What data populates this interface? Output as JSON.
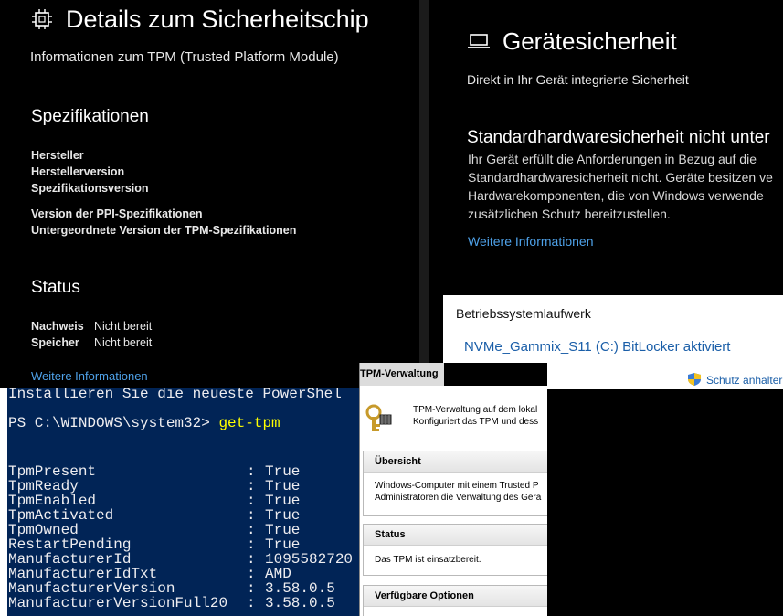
{
  "chip_details": {
    "title": "Details zum Sicherheitschip",
    "subtitle": "Informationen zum TPM (Trusted Platform Module)",
    "spec_heading": "Spezifikationen",
    "spec_labels": [
      "Hersteller",
      "Herstellerversion",
      "Spezifikationsversion"
    ],
    "spec_labels2": [
      "Version der PPI-Spezifikationen",
      "Untergeordnete Version der TPM-Spezifikationen"
    ],
    "status_heading": "Status",
    "status_rows": [
      {
        "label": "Nachweis",
        "value": "Nicht bereit"
      },
      {
        "label": "Speicher",
        "value": "Nicht bereit"
      }
    ],
    "link": "Weitere Informationen",
    "icon": "chip-icon"
  },
  "device_security": {
    "title": "Gerätesicherheit",
    "subtitle": "Direkt in Ihr Gerät integrierte Sicherheit",
    "heading": "Standardhardwaresicherheit nicht unter",
    "lines": [
      "Ihr Gerät erfüllt die Anforderungen in Bezug auf die",
      "Standardhardwaresicherheit nicht. Geräte besitzen ve",
      "Hardwarekomponenten, die von Windows verwende",
      "zusätzlichen Schutz bereitzustellen."
    ],
    "link": "Weitere Informationen",
    "icon": "laptop-icon"
  },
  "bitlocker": {
    "heading": "Betriebssystemlaufwerk",
    "drive": "NVMe_Gammix_S11 (C:) BitLocker aktiviert",
    "protect": "Schutz anhalter"
  },
  "powershell": {
    "top_line": "Installieren Sie die neueste PowerShel",
    "prompt": "PS C:\\WINDOWS\\system32> ",
    "command": "get-tpm",
    "rows": [
      {
        "key": "TpmPresent",
        "value": "True"
      },
      {
        "key": "TpmReady",
        "value": "True"
      },
      {
        "key": "TpmEnabled",
        "value": "True"
      },
      {
        "key": "TpmActivated",
        "value": "True"
      },
      {
        "key": "TpmOwned",
        "value": "True"
      },
      {
        "key": "RestartPending",
        "value": "True"
      },
      {
        "key": "ManufacturerId",
        "value": "1095582720"
      },
      {
        "key": "ManufacturerIdTxt",
        "value": "AMD"
      },
      {
        "key": "ManufacturerVersion",
        "value": "3.58.0.5"
      },
      {
        "key": "ManufacturerVersionFull20",
        "value": "3.58.0.5"
      }
    ],
    "bg_color": "#012456",
    "command_color": "#ffff00"
  },
  "tpm_mgmt": {
    "titlebar": "TPM-Verwaltung",
    "intro": [
      "TPM-Verwaltung auf dem lokal",
      "Konfiguriert das TPM und dess"
    ],
    "overview_title": "Übersicht",
    "overview_lines": [
      "Windows-Computer mit einem Trusted P",
      "Administratoren die Verwaltung des Gerä"
    ],
    "status_title": "Status",
    "status_line": "Das TPM ist einsatzbereit.",
    "options_title": "Verfügbare Optionen",
    "icon": "tpm-key-icon"
  }
}
